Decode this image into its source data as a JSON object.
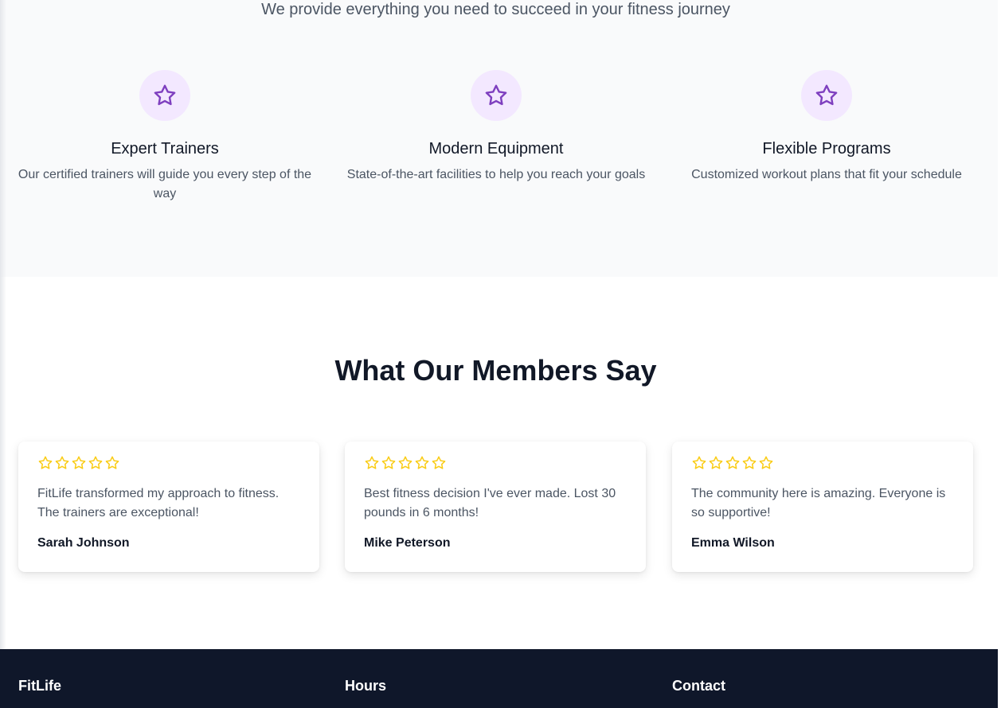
{
  "features": {
    "subtitle": "We provide everything you need to succeed in your fitness journey",
    "items": [
      {
        "icon": "star-icon",
        "title": "Expert Trainers",
        "description": "Our certified trainers will guide you every step of the way"
      },
      {
        "icon": "star-icon",
        "title": "Modern Equipment",
        "description": "State-of-the-art facilities to help you reach your goals"
      },
      {
        "icon": "star-icon",
        "title": "Flexible Programs",
        "description": "Customized workout plans that fit your schedule"
      }
    ]
  },
  "testimonials": {
    "heading": "What Our Members Say",
    "items": [
      {
        "rating": 5,
        "quote": "FitLife transformed my approach to fitness. The trainers are exceptional!",
        "author": "Sarah Johnson"
      },
      {
        "rating": 5,
        "quote": "Best fitness decision I've ever made. Lost 30 pounds in 6 months!",
        "author": "Mike Peterson"
      },
      {
        "rating": 5,
        "quote": "The community here is amazing. Everyone is so supportive!",
        "author": "Emma Wilson"
      }
    ]
  },
  "footer": {
    "brand": "FitLife",
    "hours_heading": "Hours",
    "contact_heading": "Contact"
  },
  "colors": {
    "accent": "#7e3fbf",
    "icon_bg": "#f3e8ff",
    "star": "#facc15",
    "footer_bg": "#0f172a"
  }
}
